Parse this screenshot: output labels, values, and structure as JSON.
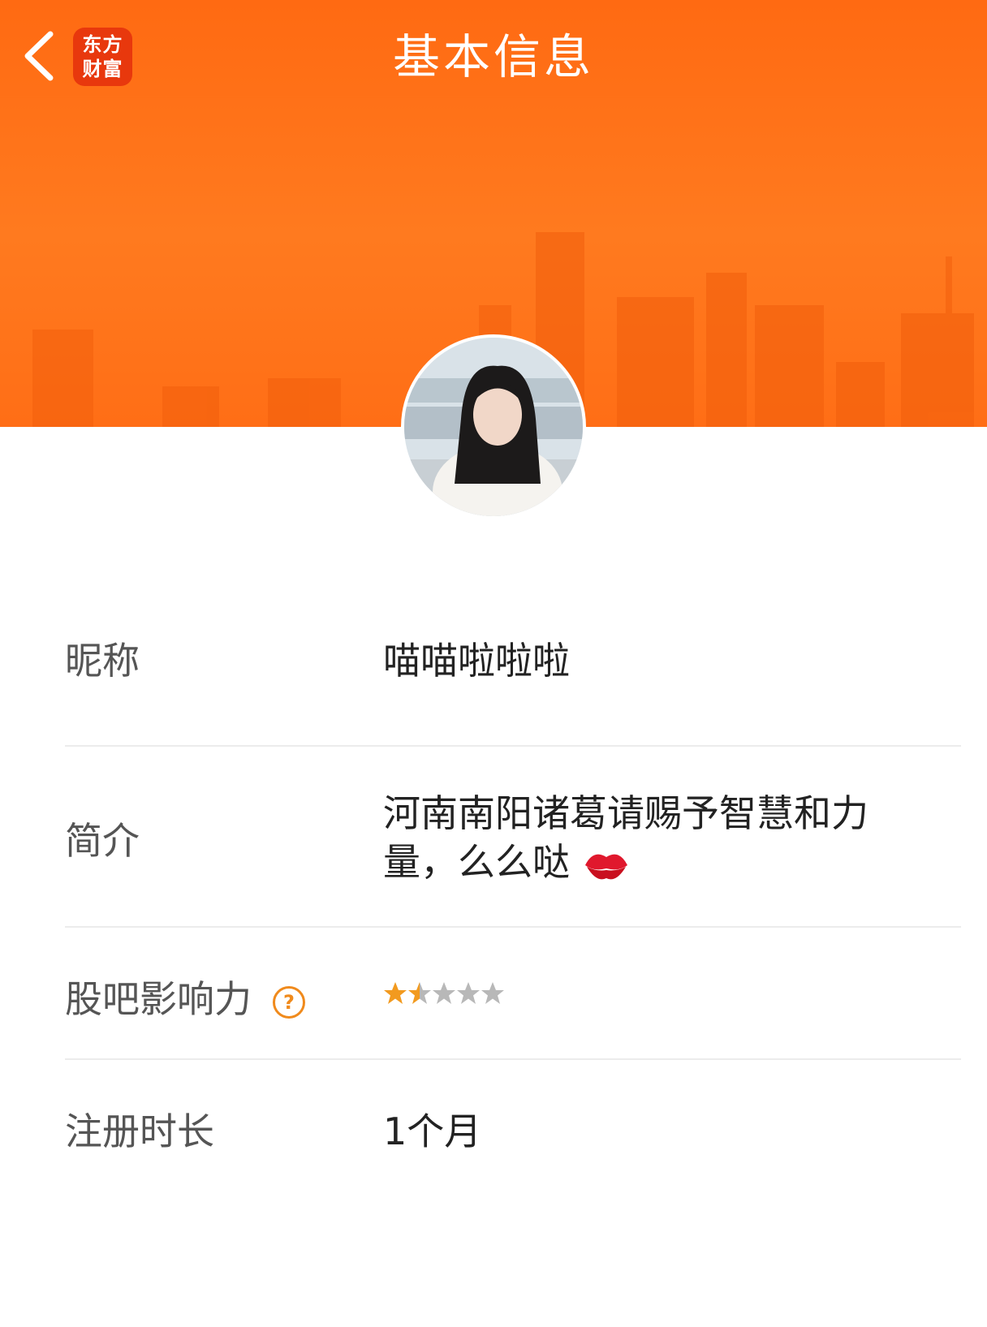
{
  "header": {
    "title": "基本信息",
    "logo_line1": "东方",
    "logo_line2": "财富",
    "accent": "#ff6a12"
  },
  "icons": {
    "back": "chevron-left-icon",
    "help": "question-circle-icon",
    "kiss": "kiss-mark-icon"
  },
  "profile": {
    "nickname_label": "昵称",
    "nickname": "喵喵啦啦啦",
    "bio_label": "简介",
    "bio_line1": "河南南阳诸葛请赐予智慧和力",
    "bio_line2": "量，么么哒",
    "influence_label": "股吧影响力",
    "influence_help": "?",
    "influence_stars": 1.5,
    "influence_max_stars": 5,
    "register_label": "注册时长",
    "register_value": "1个月"
  },
  "colors": {
    "star_filled": "#f29a1f",
    "star_empty": "#b8b8b8"
  }
}
